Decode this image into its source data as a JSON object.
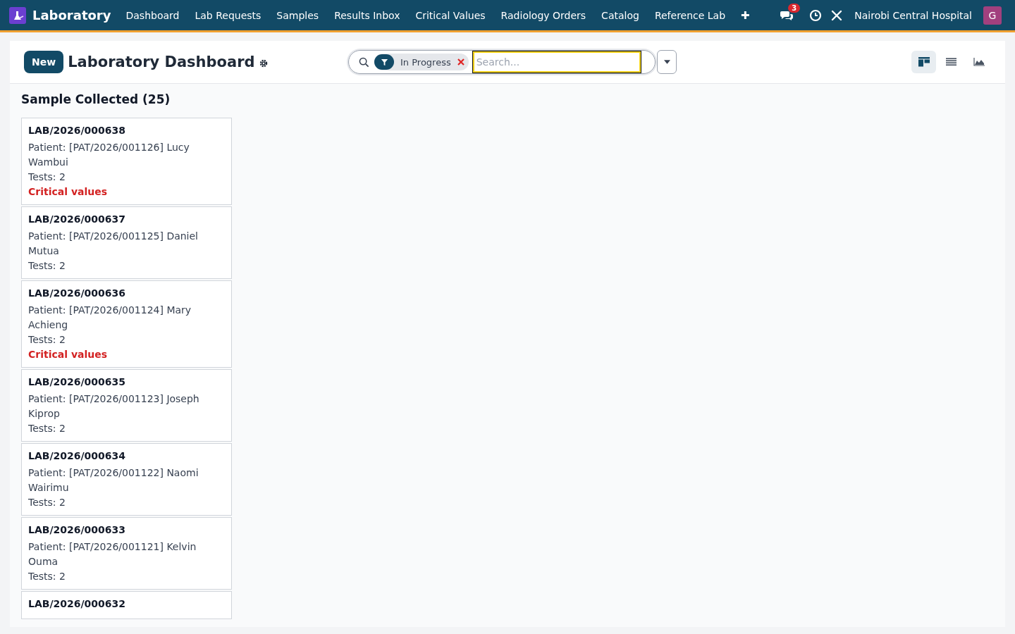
{
  "navbar": {
    "app_name": "Laboratory",
    "menu": [
      "Dashboard",
      "Lab Requests",
      "Samples",
      "Results Inbox",
      "Critical Values",
      "Radiology Orders",
      "Catalog",
      "Reference Lab"
    ],
    "add_label": "✚",
    "messages_count": "3",
    "company": "Nairobi Central Hospital",
    "user_initial": "G"
  },
  "control_panel": {
    "new_button": "New",
    "title": "Laboratory Dashboard",
    "facet": {
      "label": "In Progress"
    },
    "search": {
      "placeholder": "Search..."
    },
    "views": [
      {
        "kind": "kanban",
        "selected": true
      },
      {
        "kind": "list",
        "selected": false
      },
      {
        "kind": "graph",
        "selected": false
      }
    ]
  },
  "column": {
    "title": "Sample Collected (25)",
    "cards": [
      {
        "ref": "LAB/2026/000638",
        "patient": "Patient: [PAT/2026/001126] Lucy Wambui",
        "tests": "Tests: 2",
        "critical": "Critical values"
      },
      {
        "ref": "LAB/2026/000637",
        "patient": "Patient: [PAT/2026/001125] Daniel Mutua",
        "tests": "Tests: 2"
      },
      {
        "ref": "LAB/2026/000636",
        "patient": "Patient: [PAT/2026/001124] Mary Achieng",
        "tests": "Tests: 2",
        "critical": "Critical values"
      },
      {
        "ref": "LAB/2026/000635",
        "patient": "Patient: [PAT/2026/001123] Joseph Kiprop",
        "tests": "Tests: 2"
      },
      {
        "ref": "LAB/2026/000634",
        "patient": "Patient: [PAT/2026/001122] Naomi Wairimu",
        "tests": "Tests: 2"
      },
      {
        "ref": "LAB/2026/000633",
        "patient": "Patient: [PAT/2026/001121] Kelvin Ouma",
        "tests": "Tests: 2"
      },
      {
        "ref": "LAB/2026/000632"
      }
    ]
  }
}
